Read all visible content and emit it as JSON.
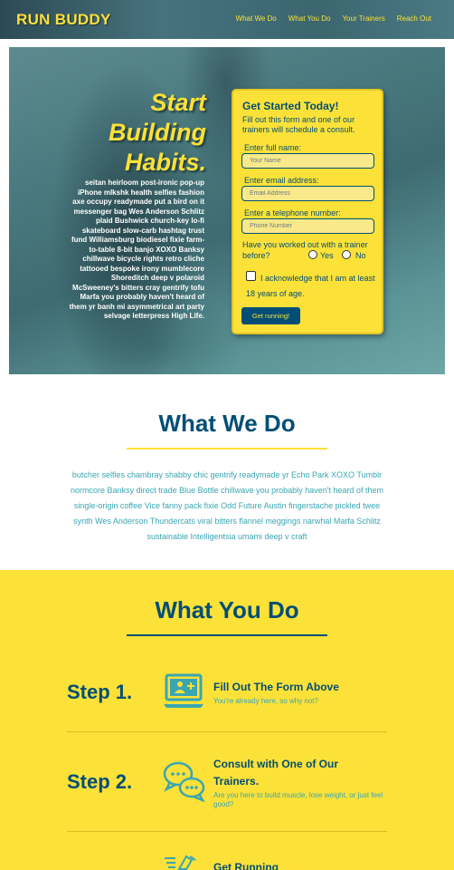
{
  "header": {
    "logo": "RUN BUDDY",
    "nav": [
      "What We Do",
      "What You Do",
      "Your Trainers",
      "Reach Out"
    ]
  },
  "hero": {
    "title_lines": [
      "Start",
      "Building",
      "Habits."
    ],
    "copy": "seitan heirloom post-ironic pop-up iPhone mlkshk health selfies fashion axe occupy readymade put a bird on it messenger bag Wes Anderson Schlitz plaid Bushwick church-key lo-fi skateboard slow-carb hashtag trust fund Williamsburg biodiesel fixie farm-to-table 8-bit banjo XOXO Banksy chillwave bicycle rights retro cliche tattooed bespoke irony mumblecore Shoreditch deep v polaroid McSweeney's bitters cray gentrify tofu Marfa you probably haven't heard of them yr banh mi asymmetrical art party selvage letterpress High Life."
  },
  "form": {
    "title": "Get Started Today!",
    "subtitle": "Fill out this form and one of our trainers will schedule a consult.",
    "name_label": "Enter full name:",
    "name_placeholder": "Your Name",
    "email_label": "Enter email address:",
    "email_placeholder": "Email Address",
    "phone_label": "Enter a telephone number:",
    "phone_placeholder": "Phone Number",
    "question": "Have you worked out with a trainer before?",
    "yes_label": "Yes",
    "no_label": "No",
    "ack_label": "I acknowledge that I am at least 18 years of age.",
    "submit_label": "Get running!"
  },
  "what_we_do": {
    "title": "What We Do",
    "text": "butcher selfies chambray shabby chic gentrify readymade yr Echo Park XOXO Tumblr normcore Banksy direct trade Blue Bottle chillwave you probably haven't heard of them single-origin coffee Vice fanny pack fixie Odd Future Austin fingerstache pickled twee synth Wes Anderson Thundercats viral bitters flannel meggings narwhal Marfa Schlitz sustainable Intelligentsia umami deep v craft"
  },
  "what_you_do": {
    "title": "What You Do",
    "steps": [
      {
        "label": "Step 1.",
        "heading": "Fill Out The Form Above",
        "sub": "You're already here, so why not?",
        "icon": "computer-add-user-icon"
      },
      {
        "label": "Step 2.",
        "heading": "Consult with One of Our Trainers.",
        "sub": "Are you here to build muscle, lose weight, or just feel good?",
        "icon": "chat-bubbles-icon"
      },
      {
        "label": "",
        "heading": "Get Running",
        "sub": "",
        "icon": "running-shoe-icon"
      }
    ]
  },
  "colors": {
    "brand_yellow": "#fce138",
    "brand_navy": "#024e76",
    "accent_teal": "#39a6b2"
  }
}
